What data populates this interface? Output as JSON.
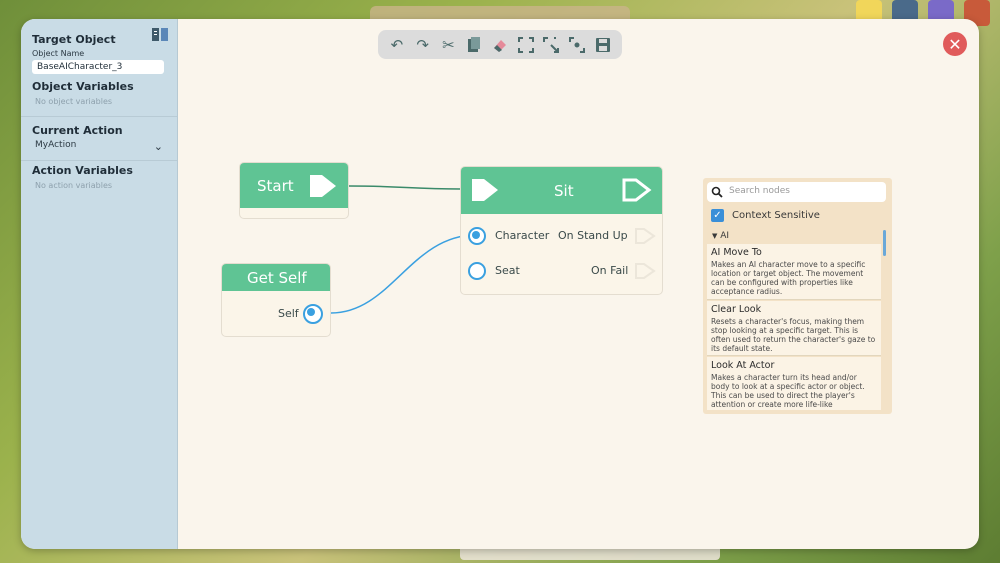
{
  "sidebar": {
    "target_object_title": "Target Object",
    "object_name_label": "Object Name",
    "object_name_value": "BaseAICharacter_3",
    "object_variables_title": "Object Variables",
    "object_variables_empty": "No object variables",
    "current_action_title": "Current Action",
    "current_action_value": "MyAction",
    "action_variables_title": "Action Variables",
    "action_variables_empty": "No action variables"
  },
  "toolbar": {
    "undo_icon": "undo-icon",
    "redo_icon": "redo-icon",
    "cut_icon": "cut-icon",
    "paste_icon": "paste-icon",
    "erase_icon": "eraser-icon",
    "fit_icon": "fit-view-icon",
    "select_icon": "select-icon",
    "center_icon": "center-icon",
    "save_icon": "save-icon"
  },
  "close_icon": "close-icon",
  "nodes": {
    "start": {
      "title": "Start"
    },
    "sit": {
      "title": "Sit",
      "inputs": [
        "Character",
        "Seat"
      ],
      "outputs": [
        "On Stand Up",
        "On Fail"
      ]
    },
    "get_self": {
      "title": "Get Self",
      "output": "Self"
    }
  },
  "search_panel": {
    "placeholder": "Search nodes",
    "context_sensitive_label": "Context Sensitive",
    "context_sensitive_checked": true,
    "category": "AI",
    "items": [
      {
        "title": "AI Move To",
        "description": "Makes an AI character move to a specific location or target object. The movement can be configured with properties like acceptance radius."
      },
      {
        "title": "Clear Look",
        "description": "Resets a character's focus, making them stop looking at a specific target. This is often used to return the character's gaze to its default state."
      },
      {
        "title": "Look At Actor",
        "description": "Makes a character turn its head and/or body to look at a specific actor or object. This can be used to direct the player's attention or create more life-like"
      }
    ]
  },
  "colors": {
    "node_header": "#5fc494",
    "wire_exec": "#3a8a6a",
    "wire_data": "#3aa0e0",
    "close_button": "#e05b5b",
    "sidebar_bg": "#c9dce6"
  }
}
